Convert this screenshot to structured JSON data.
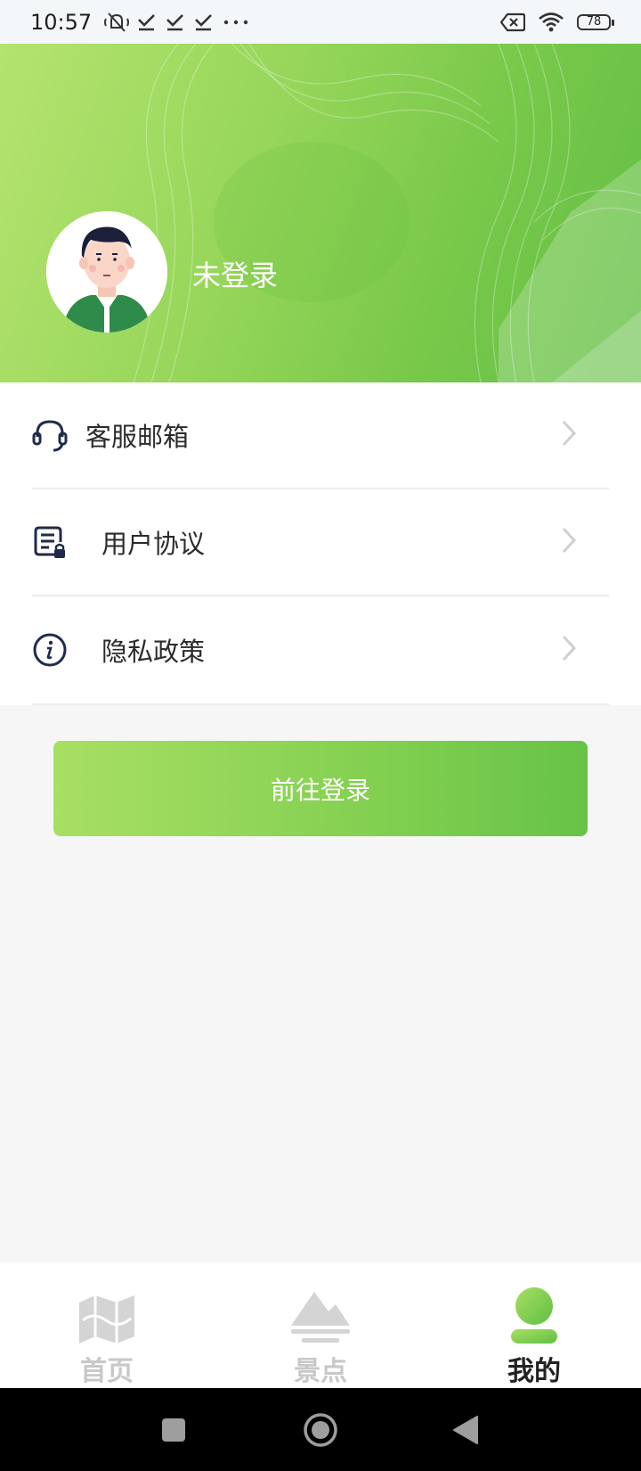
{
  "status_bar": {
    "time": "10:57",
    "battery": "78"
  },
  "profile": {
    "username": "未登录"
  },
  "menu": {
    "items": [
      {
        "label": "客服邮箱",
        "icon": "headset-icon"
      },
      {
        "label": "用户协议",
        "icon": "document-lock-icon"
      },
      {
        "label": "隐私政策",
        "icon": "info-icon"
      }
    ]
  },
  "login_button": {
    "label": "前往登录"
  },
  "tabs": [
    {
      "label": "首页",
      "icon": "map-icon",
      "active": false
    },
    {
      "label": "景点",
      "icon": "mountain-icon",
      "active": false
    },
    {
      "label": "我的",
      "icon": "user-icon",
      "active": true
    }
  ],
  "colors": {
    "accent_green": "#78c84a",
    "tab_inactive": "#c8c8c8",
    "tab_active": "#222222"
  }
}
